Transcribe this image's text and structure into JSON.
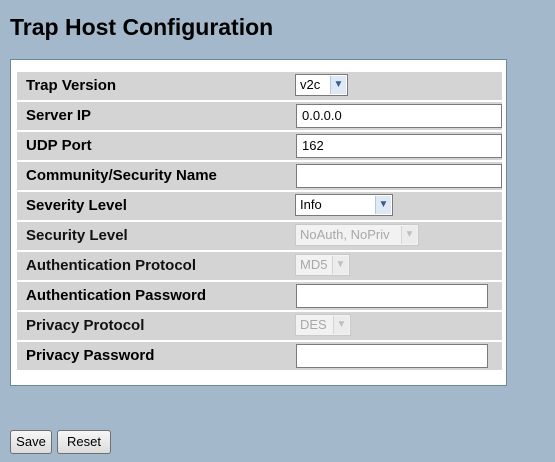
{
  "page": {
    "title": "Trap Host Configuration"
  },
  "form": {
    "trap_version": {
      "label": "Trap Version",
      "value": "v2c"
    },
    "server_ip": {
      "label": "Server IP",
      "value": "0.0.0.0"
    },
    "udp_port": {
      "label": "UDP Port",
      "value": "162"
    },
    "community": {
      "label": "Community/Security Name",
      "value": ""
    },
    "severity_level": {
      "label": "Severity Level",
      "value": "Info"
    },
    "security_level": {
      "label": "Security Level",
      "value": "NoAuth, NoPriv",
      "disabled": true
    },
    "auth_protocol": {
      "label": "Authentication Protocol",
      "value": "MD5",
      "disabled": true
    },
    "auth_password": {
      "label": "Authentication Password",
      "value": ""
    },
    "privacy_protocol": {
      "label": "Privacy Protocol",
      "value": "DES",
      "disabled": true
    },
    "privacy_password": {
      "label": "Privacy Password",
      "value": ""
    }
  },
  "buttons": {
    "save": "Save",
    "reset": "Reset"
  },
  "icons": {
    "dropdown": "chevron-down-icon"
  }
}
